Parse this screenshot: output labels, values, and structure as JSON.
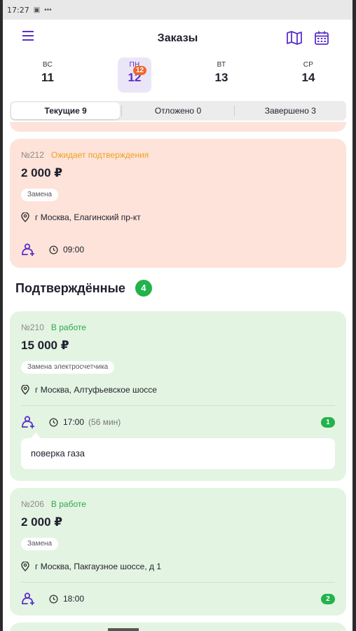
{
  "status_bar": {
    "time": "17:27"
  },
  "app_bar": {
    "title": "Заказы",
    "icons": [
      "menu-icon",
      "map-icon",
      "calendar-icon"
    ]
  },
  "days": [
    {
      "name": "ВС",
      "num": "11",
      "active": false
    },
    {
      "name": "ПН",
      "num": "12",
      "active": true,
      "badge": "12"
    },
    {
      "name": "ВТ",
      "num": "13",
      "active": false
    },
    {
      "name": "СР",
      "num": "14",
      "active": false
    }
  ],
  "tabs": [
    {
      "label": "Текущие 9",
      "active": true
    },
    {
      "label": "Отложено 0",
      "active": false
    },
    {
      "label": "Завершено 3",
      "active": false
    }
  ],
  "pending_order": {
    "number": "№212",
    "status": "Ожидает подтверждения",
    "price": "2 000 ₽",
    "service": "Замена",
    "address": "г Москва, Елагинский пр-кт",
    "time": "09:00"
  },
  "confirmed_section": {
    "title": "Подтверждённые",
    "count": "4"
  },
  "orders": [
    {
      "number": "№210",
      "status": "В работе",
      "price": "15 000 ₽",
      "service": "Замена электросчетчика",
      "address": "г Москва, Алтуфьевское шоссе",
      "time": "17:00",
      "duration": "(56 мин)",
      "comments_count": "1",
      "comment": "поверка газа"
    },
    {
      "number": "№206",
      "status": "В работе",
      "price": "2 000 ₽",
      "service": "Замена",
      "address": "г Москва, Пакгаузное шоссе, д 1",
      "time": "18:00",
      "comments_count": "2"
    }
  ],
  "colors": {
    "accent": "#5b2fc9",
    "pending_bg": "#fde3d9",
    "confirmed_bg": "#e3f4e2",
    "status_wait": "#f0a020",
    "status_work": "#2ea84a",
    "badge_orange": "#f2662b",
    "badge_green": "#22b34c"
  }
}
